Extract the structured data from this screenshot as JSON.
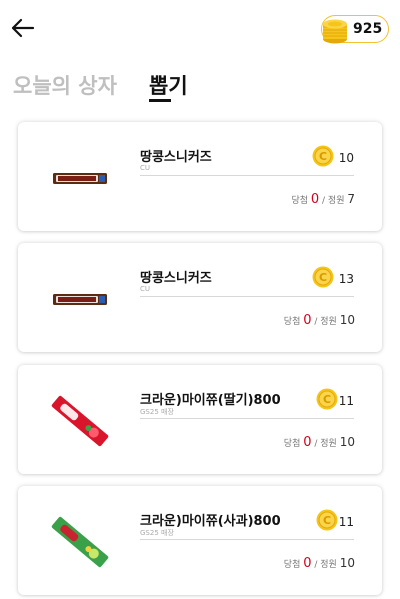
{
  "header": {
    "coin_count": "925"
  },
  "tabs": {
    "today_box": "오늘의 상자",
    "draw": "뽑기"
  },
  "items": [
    {
      "name": "땅콩스니커즈",
      "store": "CU",
      "price": "10",
      "win_label": "당첨",
      "win_count": "0",
      "cap_label": "정원",
      "cap_count": "7",
      "product": "snickers"
    },
    {
      "name": "땅콩스니커즈",
      "store": "CU",
      "price": "13",
      "win_label": "당첨",
      "win_count": "0",
      "cap_label": "정원",
      "cap_count": "10",
      "product": "snickers"
    },
    {
      "name": "크라운)마이쮸(딸기)800",
      "store": "GS25 매장",
      "price": "11",
      "win_label": "당첨",
      "win_count": "0",
      "cap_label": "정원",
      "cap_count": "10",
      "product": "mychew-strawberry"
    },
    {
      "name": "크라운)마이쮸(사과)800",
      "store": "GS25 매장",
      "price": "11",
      "win_label": "당첨",
      "win_count": "0",
      "cap_label": "정원",
      "cap_count": "10",
      "product": "mychew-apple"
    }
  ],
  "colors": {
    "coin": "#f5c518",
    "win": "#d0021b",
    "accent": "#f1c232"
  }
}
